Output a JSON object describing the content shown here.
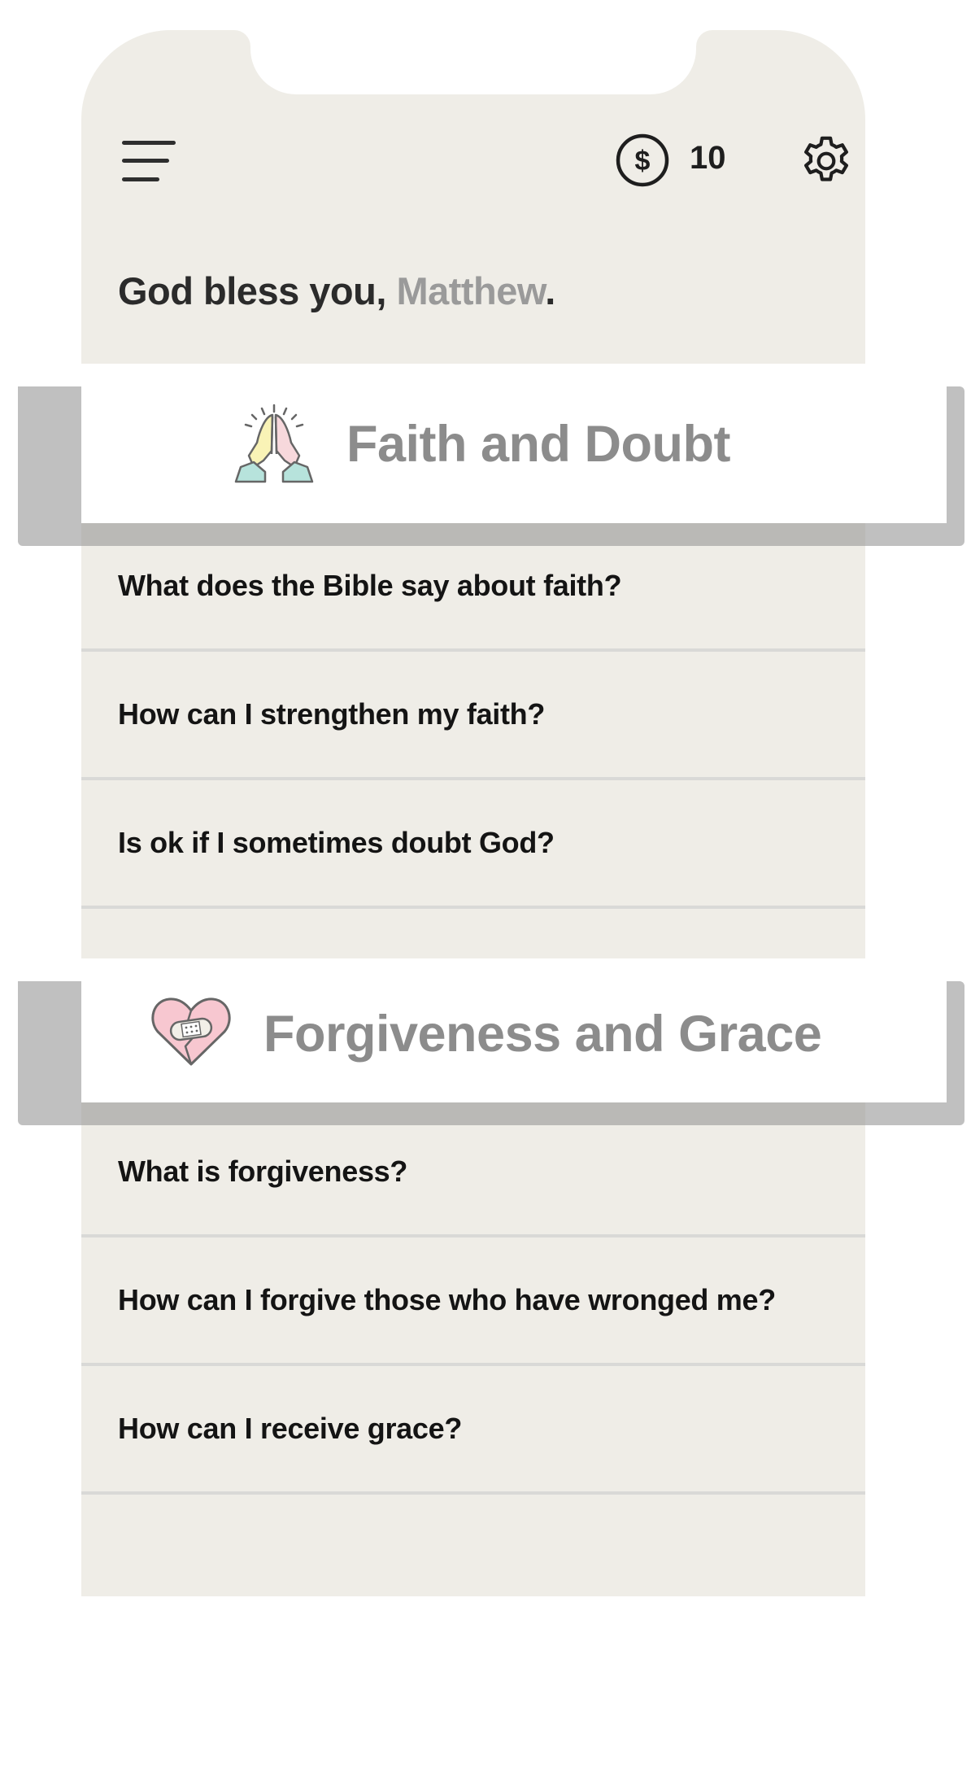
{
  "header": {
    "menu_icon": "hamburger-menu-icon",
    "coin_icon": "dollar-coin-icon",
    "coin_count": "10",
    "settings_icon": "gear-icon"
  },
  "greeting": {
    "prefix": "God bless you, ",
    "name": "Matthew",
    "suffix": "."
  },
  "sections": [
    {
      "title": "Faith and Doubt",
      "icon": "praying-hands-icon",
      "questions": [
        "What does the Bible say about faith?",
        "How can I strengthen my faith?",
        "Is ok if I sometimes doubt God?"
      ]
    },
    {
      "title": "Forgiveness and Grace",
      "icon": "bandaged-heart-icon",
      "questions": [
        "What is forgiveness?",
        "How can I forgive those who have wronged me?",
        "How can I receive grace?"
      ]
    }
  ],
  "colors": {
    "background": "#efede7",
    "card": "#ffffff",
    "title_gray": "#8c8c8c",
    "name_gray": "#9a9a9a",
    "divider": "#d9d9d7"
  }
}
